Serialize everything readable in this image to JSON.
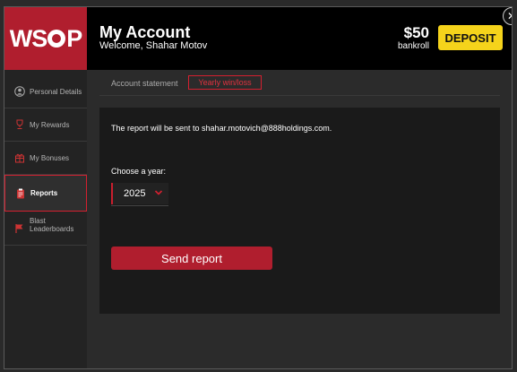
{
  "header": {
    "logo_text_left": "WS",
    "logo_text_right": "P",
    "title": "My Account",
    "welcome": "Welcome, Shahar Motov",
    "bankroll_amount": "$50",
    "bankroll_label": "bankroll",
    "deposit_label": "DEPOSIT",
    "close_symbol": "✕"
  },
  "sidebar": {
    "items": [
      {
        "label": "Personal Details",
        "icon": "person-icon"
      },
      {
        "label": "My Rewards",
        "icon": "trophy-icon"
      },
      {
        "label": "My Bonuses",
        "icon": "gift-icon"
      },
      {
        "label": "Reports",
        "icon": "clipboard-icon",
        "active": true
      },
      {
        "label": "Blast Leaderboards",
        "icon": "flag-icon"
      }
    ]
  },
  "tabs": {
    "statement": "Account statement",
    "yearly": "Yearly win/loss"
  },
  "report": {
    "message": "The report will be sent to shahar.motovich@888holdings.com.",
    "choose_label": "Choose a year:",
    "selected_year": "2025",
    "send_label": "Send report"
  },
  "colors": {
    "brand_red": "#b01e2e",
    "highlight_red": "#d42030",
    "deposit_yellow": "#f5d31b"
  }
}
